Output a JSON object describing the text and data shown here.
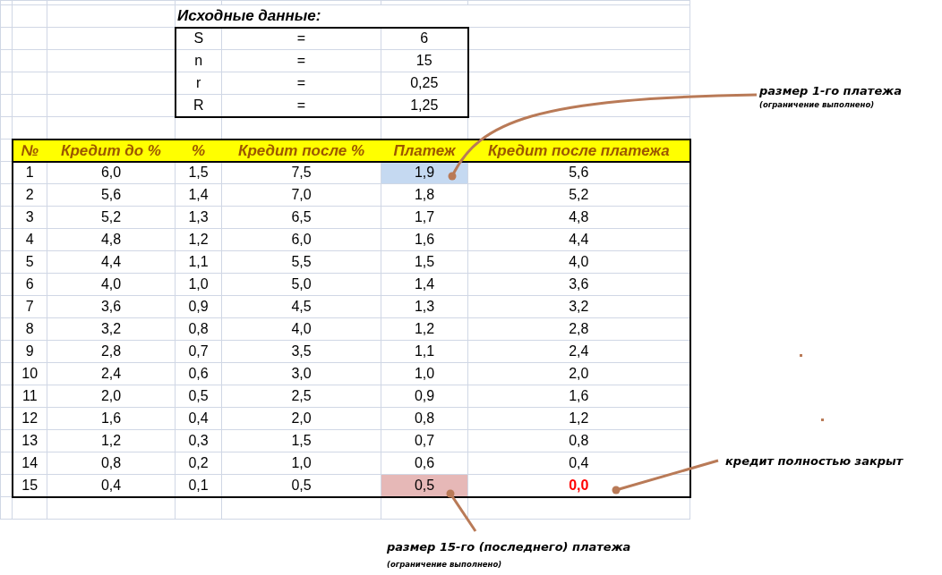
{
  "parameters_title": "Исходные данные:",
  "parameters": [
    {
      "name": "S",
      "sign": "=",
      "value": "6"
    },
    {
      "name": "n",
      "sign": "=",
      "value": "15"
    },
    {
      "name": "r",
      "sign": "=",
      "value": "0,25"
    },
    {
      "name": "R",
      "sign": "=",
      "value": "1,25"
    }
  ],
  "table": {
    "columns": [
      "№",
      "Кредит до %",
      "%",
      "Кредит после %",
      "Платеж",
      "Кредит после платежа"
    ],
    "rows": [
      {
        "cells": [
          "1",
          "6,0",
          "1,5",
          "7,5",
          "1,9",
          "5,6"
        ],
        "color": "#c5d9f1",
        "remaining_emphasis": false
      },
      {
        "cells": [
          "2",
          "5,6",
          "1,4",
          "7,0",
          "1,8",
          "5,2"
        ],
        "remaining_emphasis": false
      },
      {
        "cells": [
          "3",
          "5,2",
          "1,3",
          "6,5",
          "1,7",
          "4,8"
        ],
        "remaining_emphasis": false
      },
      {
        "cells": [
          "4",
          "4,8",
          "1,2",
          "6,0",
          "1,6",
          "4,4"
        ],
        "remaining_emphasis": false
      },
      {
        "cells": [
          "5",
          "4,4",
          "1,1",
          "5,5",
          "1,5",
          "4,0"
        ],
        "remaining_emphasis": false
      },
      {
        "cells": [
          "6",
          "4,0",
          "1,0",
          "5,0",
          "1,4",
          "3,6"
        ],
        "remaining_emphasis": false
      },
      {
        "cells": [
          "7",
          "3,6",
          "0,9",
          "4,5",
          "1,3",
          "3,2"
        ],
        "remaining_emphasis": false
      },
      {
        "cells": [
          "8",
          "3,2",
          "0,8",
          "4,0",
          "1,2",
          "2,8"
        ],
        "remaining_emphasis": false
      },
      {
        "cells": [
          "9",
          "2,8",
          "0,7",
          "3,5",
          "1,1",
          "2,4"
        ],
        "remaining_emphasis": false
      },
      {
        "cells": [
          "10",
          "2,4",
          "0,6",
          "3,0",
          "1,0",
          "2,0"
        ],
        "remaining_emphasis": false
      },
      {
        "cells": [
          "11",
          "2,0",
          "0,5",
          "2,5",
          "0,9",
          "1,6"
        ],
        "remaining_emphasis": false
      },
      {
        "cells": [
          "12",
          "1,6",
          "0,4",
          "2,0",
          "0,8",
          "1,2"
        ],
        "remaining_emphasis": false
      },
      {
        "cells": [
          "13",
          "1,2",
          "0,3",
          "1,5",
          "0,7",
          "0,8"
        ],
        "remaining_emphasis": false
      },
      {
        "cells": [
          "14",
          "0,8",
          "0,2",
          "1,0",
          "0,6",
          "0,4"
        ],
        "remaining_emphasis": false
      },
      {
        "cells": [
          "15",
          "0,4",
          "0,1",
          "0,5",
          "0,5",
          "0,0"
        ],
        "color": "#e6b8b7",
        "remaining_emphasis": true
      }
    ]
  },
  "annotations": [
    {
      "title": "размер 1-го платежа",
      "note": "(ограничение выполнено)"
    },
    {
      "title": "кредит полностью закрыт"
    },
    {
      "title": "размер 15-го (последнего) платежа",
      "note": "(ограничение выполнено)"
    }
  ]
}
